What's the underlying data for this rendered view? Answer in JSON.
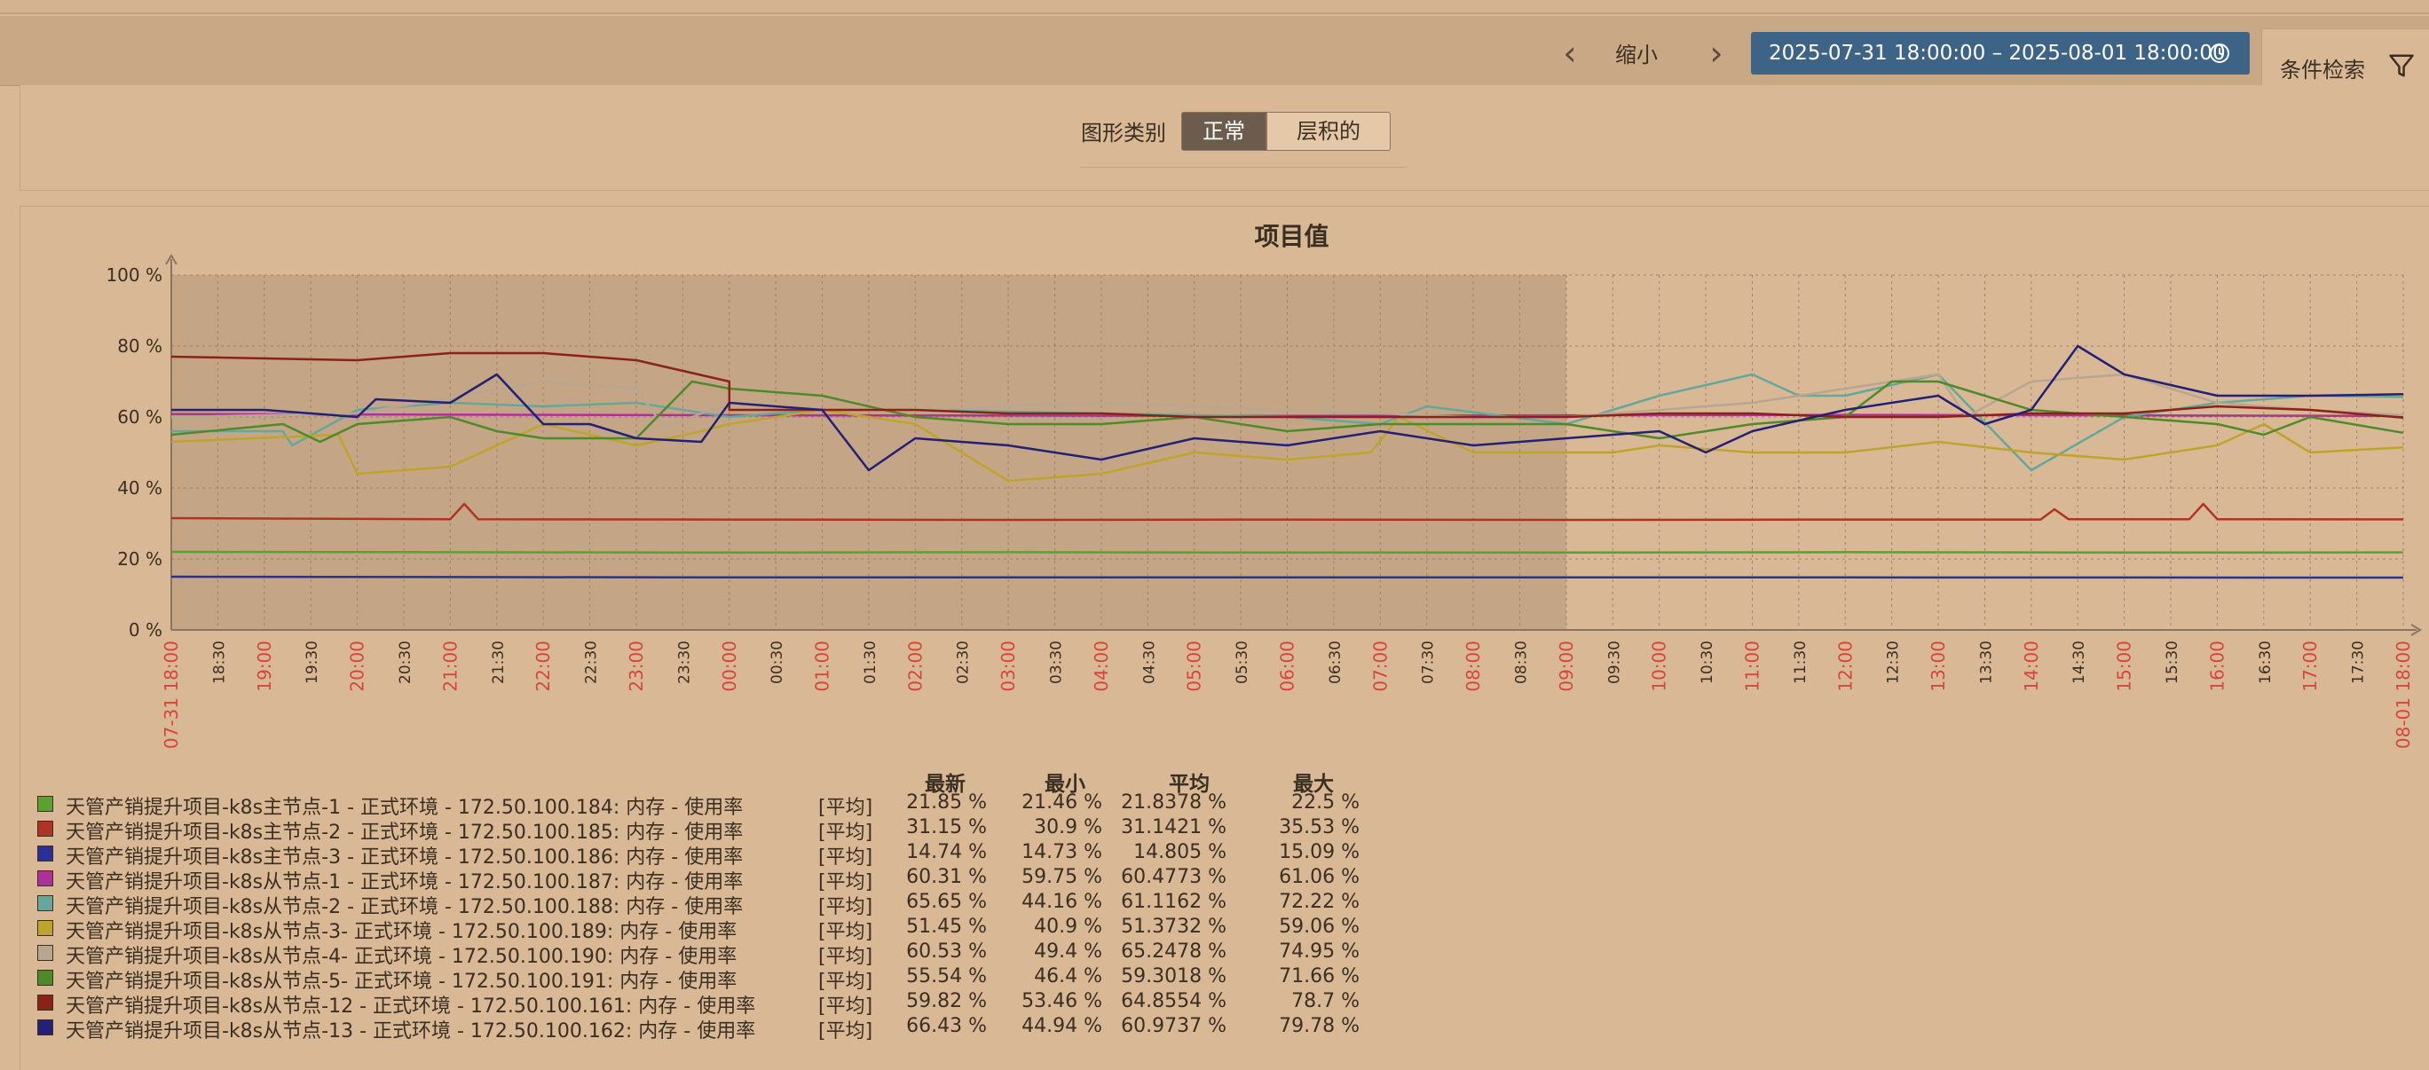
{
  "filter_bar": {
    "prev_label": "‹",
    "zoom_label": "缩小",
    "next_label": "›",
    "time_range": "2025-07-31 18:00:00 – 2025-08-01 18:00:00",
    "search_label": "条件检索",
    "clock_icon": "clock-icon",
    "filter_icon": "filter-icon"
  },
  "graph_type": {
    "label": "图形类别",
    "options": [
      "正常",
      "层积的"
    ],
    "selected": "正常"
  },
  "legend_headers": {
    "last": "最新",
    "min": "最小",
    "avg": "平均",
    "max": "最大"
  },
  "legend": [
    {
      "name": "天管产销提升项目-k8s主节点-1 - 正式环境 - 172.50.100.184: 内存 - 使用率",
      "func": "[平均]",
      "last": "21.85 %",
      "min": "21.46 %",
      "avg": "21.8378 %",
      "max": "22.5 %",
      "color": "#5aa12f"
    },
    {
      "name": "天管产销提升项目-k8s主节点-2 - 正式环境 - 172.50.100.185: 内存 - 使用率",
      "func": "[平均]",
      "last": "31.15 %",
      "min": "30.9 %",
      "avg": "31.1421 %",
      "max": "35.53 %",
      "color": "#b03426"
    },
    {
      "name": "天管产销提升项目-k8s主节点-3 - 正式环境 - 172.50.100.186: 内存 - 使用率",
      "func": "[平均]",
      "last": "14.74 %",
      "min": "14.73 %",
      "avg": "14.805 %",
      "max": "15.09 %",
      "color": "#2b2f96"
    },
    {
      "name": "天管产销提升项目-k8s从节点-1 - 正式环境 - 172.50.100.187: 内存 - 使用率",
      "func": "[平均]",
      "last": "60.31 %",
      "min": "59.75 %",
      "avg": "60.4773 %",
      "max": "61.06 %",
      "color": "#b0309a"
    },
    {
      "name": "天管产销提升项目-k8s从节点-2 - 正式环境 - 172.50.100.188: 内存 - 使用率",
      "func": "[平均]",
      "last": "65.65 %",
      "min": "44.16 %",
      "avg": "61.1162 %",
      "max": "72.22 %",
      "color": "#63a89a"
    },
    {
      "name": "天管产销提升项目-k8s从节点-3- 正式环境 - 172.50.100.189: 内存 - 使用率",
      "func": "[平均]",
      "last": "51.45 %",
      "min": "40.9 %",
      "avg": "51.3732 %",
      "max": "59.06 %",
      "color": "#bea42a"
    },
    {
      "name": "天管产销提升项目-k8s从节点-4- 正式环境 - 172.50.100.190: 内存 - 使用率",
      "func": "[平均]",
      "last": "60.53 %",
      "min": "49.4 %",
      "avg": "65.2478 %",
      "max": "74.95 %",
      "color": "#b9a690"
    },
    {
      "name": "天管产销提升项目-k8s从节点-5- 正式环境 - 172.50.100.191: 内存 - 使用率",
      "func": "[平均]",
      "last": "55.54 %",
      "min": "46.4 %",
      "avg": "59.3018 %",
      "max": "71.66 %",
      "color": "#4f8a2a"
    },
    {
      "name": "天管产销提升项目-k8s从节点-12 - 正式环境 - 172.50.100.161: 内存 - 使用率",
      "func": "[平均]",
      "last": "59.82 %",
      "min": "53.46 %",
      "avg": "64.8554 %",
      "max": "78.7 %",
      "color": "#8a2218"
    },
    {
      "name": "天管产销提升项目-k8s从节点-13 - 正式环境 - 172.50.100.162: 内存 - 使用率",
      "func": "[平均]",
      "last": "66.43 %",
      "min": "44.94 %",
      "avg": "60.9737 %",
      "max": "79.78 %",
      "color": "#232075"
    }
  ],
  "chart_data": {
    "type": "line",
    "title": "项目值",
    "ylim": [
      0,
      100
    ],
    "y_ticks": [
      "0 %",
      "20 %",
      "40 %",
      "60 %",
      "80 %",
      "100 %"
    ],
    "x_ticks": [
      "07-31 18:00",
      "18:30",
      "19:00",
      "19:30",
      "20:00",
      "20:30",
      "21:00",
      "21:30",
      "22:00",
      "22:30",
      "23:00",
      "23:30",
      "00:00",
      "00:30",
      "01:00",
      "01:30",
      "02:00",
      "02:30",
      "03:00",
      "03:30",
      "04:00",
      "04:30",
      "05:00",
      "05:30",
      "06:00",
      "06:30",
      "07:00",
      "07:30",
      "08:00",
      "08:30",
      "09:00",
      "09:30",
      "10:00",
      "10:30",
      "11:00",
      "11:30",
      "12:00",
      "12:30",
      "13:00",
      "13:30",
      "14:00",
      "14:30",
      "15:00",
      "15:30",
      "16:00",
      "16:30",
      "17:00",
      "17:30",
      "08-01 18:00"
    ],
    "highlight_ticks": [
      "07-31 18:00",
      "19:00",
      "20:00",
      "21:00",
      "22:00",
      "23:00",
      "00:00",
      "01:00",
      "02:00",
      "03:00",
      "04:00",
      "05:00",
      "06:00",
      "07:00",
      "08:00",
      "09:00",
      "10:00",
      "11:00",
      "12:00",
      "13:00",
      "14:00",
      "15:00",
      "16:00",
      "17:00",
      "08-01 18:00"
    ],
    "shaded_range_hours": [
      0,
      15
    ],
    "grid": true,
    "series": [
      {
        "color": "#5aa12f",
        "x": [
          0,
          3,
          6,
          9,
          12,
          15,
          18,
          21,
          24
        ],
        "y": [
          22,
          21.9,
          21.8,
          21.9,
          21.8,
          21.8,
          21.9,
          21.8,
          21.85
        ]
      },
      {
        "color": "#b03426",
        "x": [
          0,
          3,
          3.15,
          3.3,
          6,
          9,
          12,
          15,
          18,
          20.1,
          20.25,
          20.4,
          21.7,
          21.85,
          22,
          24
        ],
        "y": [
          31.5,
          31.2,
          35.5,
          31.2,
          31.1,
          31,
          31.1,
          31,
          31.1,
          31.1,
          34,
          31.2,
          31.2,
          35.5,
          31.2,
          31.15
        ]
      },
      {
        "color": "#2b2f96",
        "x": [
          0,
          6,
          12,
          18,
          24
        ],
        "y": [
          15,
          14.8,
          14.8,
          14.8,
          14.74
        ]
      },
      {
        "color": "#b0309a",
        "x": [
          0,
          6,
          12,
          18,
          24
        ],
        "y": [
          60.8,
          60.5,
          60.3,
          60.6,
          60.31
        ]
      },
      {
        "color": "#63a89a",
        "x": [
          0,
          1.2,
          1.3,
          2,
          3,
          4,
          5,
          6,
          7,
          8,
          10,
          12,
          13,
          13.5,
          15,
          15.5,
          16,
          17,
          17.5,
          18,
          19,
          20,
          21,
          22,
          23,
          24
        ],
        "y": [
          56,
          56,
          52,
          62,
          64,
          63,
          64,
          60,
          62,
          62,
          61,
          60,
          58,
          63,
          58,
          62,
          66,
          72,
          66,
          66,
          72,
          45,
          60,
          64,
          66,
          65.65
        ]
      },
      {
        "color": "#bea42a",
        "x": [
          0,
          1.8,
          2,
          3,
          4,
          5,
          5.7,
          6,
          7,
          8,
          9,
          10,
          11,
          12,
          12.9,
          13.2,
          14,
          15,
          15.5,
          16,
          17,
          18,
          19,
          20,
          21,
          22,
          22.5,
          23,
          24
        ],
        "y": [
          53,
          55,
          44,
          46,
          58,
          52,
          56,
          58,
          62,
          58,
          42,
          44,
          50,
          48,
          50,
          60,
          50,
          50,
          50,
          52,
          50,
          50,
          53,
          50,
          48,
          52,
          58,
          50,
          51.45
        ]
      },
      {
        "color": "#b9a690",
        "x": [
          0,
          2,
          4,
          5,
          5.3,
          5.8,
          7,
          8,
          10,
          12,
          14,
          15,
          16,
          17,
          18,
          19,
          19.3,
          20,
          21,
          22,
          23,
          24
        ],
        "y": [
          60,
          61,
          70,
          68,
          57,
          62,
          62,
          62,
          64,
          62,
          60,
          60,
          62,
          64,
          68,
          72,
          60,
          70,
          72,
          64,
          62,
          60.53
        ]
      },
      {
        "color": "#4f8a2a",
        "x": [
          0,
          1.2,
          1.6,
          2,
          3,
          3.5,
          4,
          5,
          5.6,
          6,
          7,
          8,
          9,
          10,
          11,
          12,
          13,
          14,
          15,
          15.5,
          16,
          17,
          18,
          18.5,
          19,
          20,
          21,
          22,
          22.5,
          23,
          24
        ],
        "y": [
          55,
          58,
          53,
          58,
          60,
          56,
          54,
          54,
          70,
          68,
          66,
          60,
          58,
          58,
          60,
          56,
          58,
          58,
          58,
          56,
          54,
          58,
          60,
          70,
          70,
          62,
          60,
          58,
          55,
          60,
          55.54
        ]
      },
      {
        "color": "#8a2218",
        "x": [
          0,
          2,
          3,
          4,
          5,
          6,
          6,
          7,
          8,
          9,
          10,
          11,
          12,
          13,
          14,
          15,
          16,
          17,
          18,
          19,
          20,
          21,
          22,
          23,
          24
        ],
        "y": [
          77,
          76,
          78,
          78,
          76,
          70,
          62,
          62,
          62,
          61,
          61,
          60,
          60,
          60,
          60,
          60,
          61,
          61,
          60,
          60,
          61,
          61,
          63,
          62,
          59.82
        ]
      },
      {
        "color": "#232075",
        "x": [
          0,
          1,
          2,
          2.2,
          3,
          3.5,
          4,
          4.5,
          5,
          5.7,
          6,
          7,
          7.5,
          8,
          9,
          10,
          11,
          12,
          13,
          14,
          15,
          16,
          16.5,
          17,
          18,
          19,
          19.5,
          20,
          20.5,
          21,
          22,
          23,
          24
        ],
        "y": [
          62,
          62,
          60,
          65,
          64,
          72,
          58,
          58,
          54,
          53,
          64,
          62,
          45,
          54,
          52,
          48,
          54,
          52,
          56,
          52,
          54,
          56,
          50,
          56,
          62,
          66,
          58,
          62,
          80,
          72,
          66,
          66,
          66.43
        ]
      }
    ]
  }
}
